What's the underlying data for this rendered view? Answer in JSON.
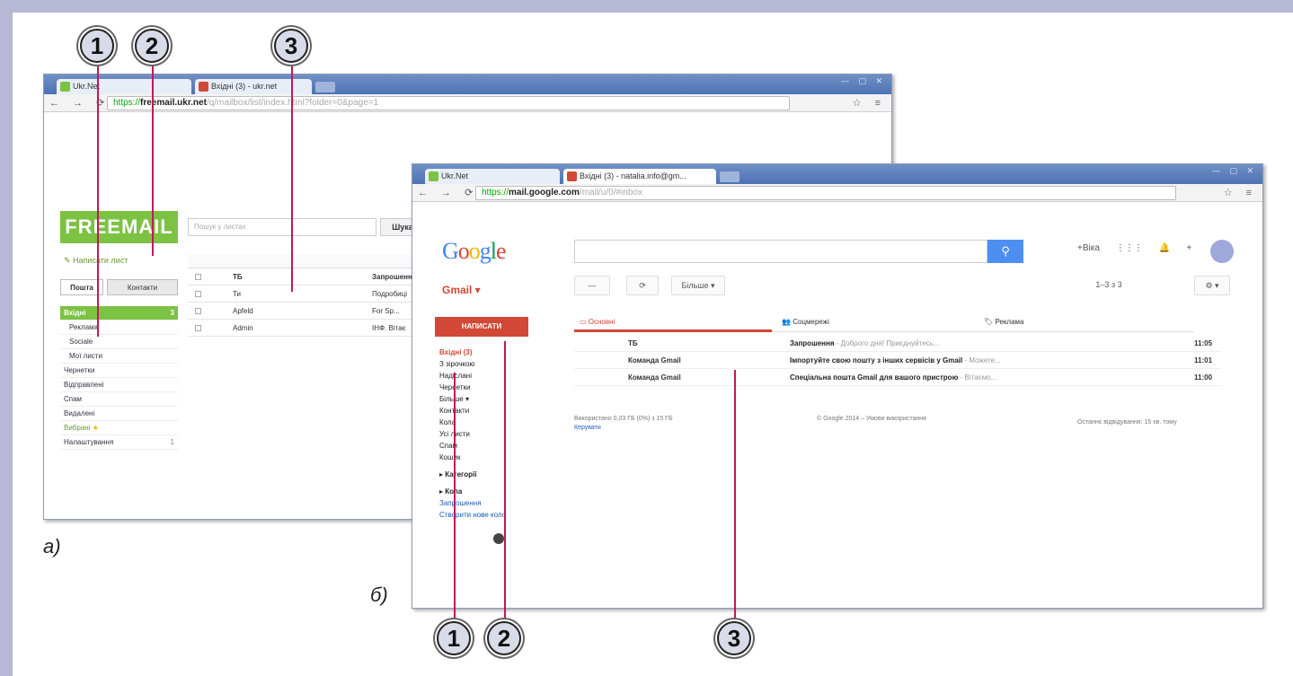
{
  "callouts": {
    "a": [
      "1",
      "2",
      "3"
    ],
    "b": [
      "1",
      "2",
      "3"
    ]
  },
  "figure_labels": {
    "a": "а)",
    "b": "б)"
  },
  "freemail": {
    "tabs": [
      "Ukr.Net",
      "Вхідні (3) - ukr.net"
    ],
    "address": {
      "domain": "freemail.ukr.net",
      "path": "/q/mailbox/list/index.html?folder=0&page=1",
      "prefix": "https://"
    },
    "logo": "FREEMAIL",
    "new_message": "Написати лист",
    "side_tabs": [
      "Пошта",
      "Контакти"
    ],
    "search_placeholder": "Пошук у листах",
    "search_button": "Шукати",
    "folders": [
      {
        "label": "Вхідні",
        "count": "3"
      },
      {
        "label": "Рекламa",
        "count": ""
      },
      {
        "label": "Sociale",
        "count": ""
      },
      {
        "label": "Мої листи",
        "count": ""
      },
      {
        "label": "Чернетки",
        "count": ""
      },
      {
        "label": "Відправлені",
        "count": ""
      },
      {
        "label": "Спам",
        "count": ""
      },
      {
        "label": "Видалені",
        "count": ""
      },
      {
        "label": "Вибрані",
        "count": ""
      },
      {
        "label": "Налаштування",
        "count": "1"
      }
    ],
    "messages": [
      {
        "from": "ТБ",
        "subject": "Запрошення"
      },
      {
        "from": "Ти",
        "subject": "Подробиці"
      },
      {
        "from": "Apfeld",
        "subject": "For Sp..."
      },
      {
        "from": "Admin",
        "subject": "ІНФ. Вітає"
      }
    ]
  },
  "gmail": {
    "tabs": [
      "Ukr.Net",
      "Вхідні (3) - natalia.info@gm..."
    ],
    "address": {
      "prefix": "https://",
      "domain": "mail.google.com",
      "path": "/mail/u/0/#inbox"
    },
    "logo_letters": [
      "G",
      "o",
      "o",
      "g",
      "l",
      "e"
    ],
    "logo_colors": [
      "#4285f4",
      "#db4437",
      "#f4b400",
      "#4285f4",
      "#0f9d58",
      "#db4437"
    ],
    "mail_label": "Gmail ▾",
    "compose": "НАПИСАТИ",
    "top_right": [
      "+Віка",
      "⋮⋮⋮",
      "🔔",
      "+"
    ],
    "nav": [
      "Вхідні (3)",
      "З зірочкою",
      "Надіслані",
      "Чернетки",
      "Більше ▾",
      "Контакти",
      "Кола",
      "Усі листи",
      "Спам",
      "Кошик"
    ],
    "nav_sections": [
      "▸ Категорії",
      "▸ Кола"
    ],
    "nav_links": [
      "Запрошення",
      "Створити нове коло"
    ],
    "toolbar": {
      "select": "—",
      "refresh": "⟳",
      "more": "Більше ▾",
      "range": "1–3 з 3",
      "settings": "⚙ ▾"
    },
    "category_tabs": [
      "Основні",
      "Соцмережі",
      "Реклама"
    ],
    "messages": [
      {
        "from": "ТБ",
        "subject": "Запрошення",
        "preview": " - Доброго дня! Приєднуйтесь...",
        "time": "11:05"
      },
      {
        "from": "Команда Gmail",
        "subject": "Імпортуйте свою пошту з інших сервісів у Gmail",
        "preview": " - Можете...",
        "time": "11:01"
      },
      {
        "from": "Команда Gmail",
        "subject": "Спеціальна пошта Gmail для вашого пристрою",
        "preview": " - Вітаємо...",
        "time": "11:00"
      }
    ],
    "footer": {
      "storage": "Використано 0,03 ГБ (0%) з 15 ГБ",
      "manage": "Керувати",
      "terms": "© Google 2014 – Умови використання",
      "activity": "Останнє відвідування: 15 хв. тому"
    }
  }
}
